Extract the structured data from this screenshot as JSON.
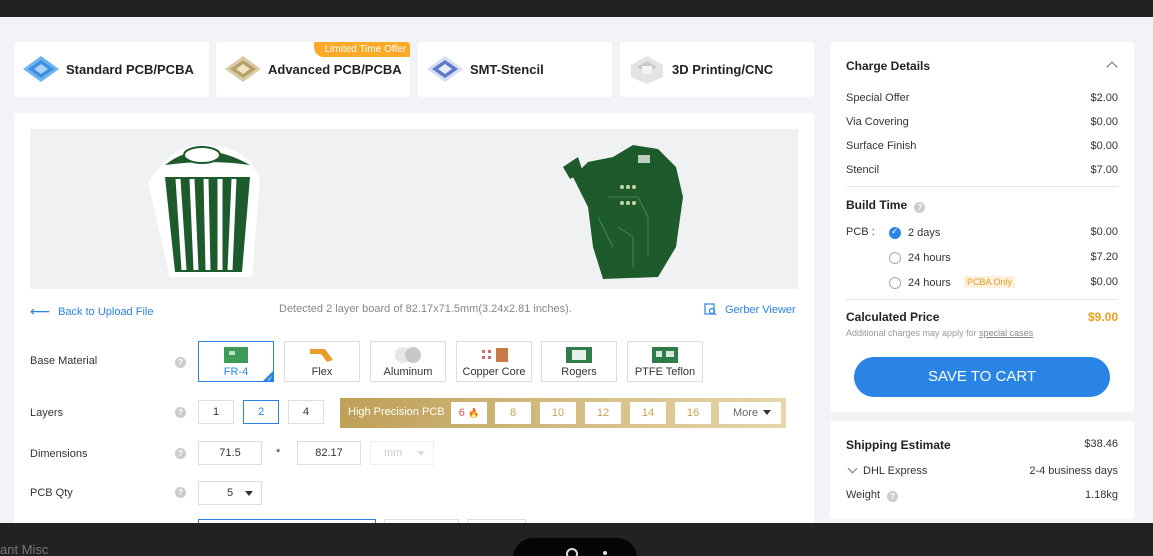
{
  "tabs": [
    {
      "label": "Standard PCB/PCBA"
    },
    {
      "label": "Advanced PCB/PCBA",
      "badge": "Limited Time Offer"
    },
    {
      "label": "SMT-Stencil"
    },
    {
      "label": "3D Printing/CNC"
    }
  ],
  "upload": {
    "back_label": "Back to Upload File",
    "detected_text": "Detected 2 layer board of 82.17x71.5mm(3.24x2.81 inches).",
    "gerber_label": "Gerber Viewer"
  },
  "fields": {
    "base_material": {
      "label": "Base Material",
      "options": [
        "FR-4",
        "Flex",
        "Aluminum",
        "Copper Core",
        "Rogers",
        "PTFE Teflon"
      ],
      "selected": "FR-4"
    },
    "layers": {
      "label": "Layers",
      "options": [
        "1",
        "2",
        "4"
      ],
      "selected": "2",
      "high_precision_label": "High Precision PCB",
      "high_precision_options": [
        "6",
        "8",
        "10",
        "12",
        "14",
        "16"
      ],
      "more_label": "More"
    },
    "dimensions": {
      "label": "Dimensions",
      "width": "71.5",
      "separator": "*",
      "height": "82.17",
      "unit": "mm"
    },
    "pcb_qty": {
      "label": "PCB Qty",
      "value": "5"
    },
    "help_icon": "?"
  },
  "charge": {
    "title": "Charge Details",
    "lines": [
      {
        "label": "Special Offer",
        "value": "$2.00"
      },
      {
        "label": "Via Covering",
        "value": "$0.00"
      },
      {
        "label": "Surface Finish",
        "value": "$0.00"
      },
      {
        "label": "Stencil",
        "value": "$7.00"
      }
    ],
    "build_time": {
      "title": "Build Time",
      "pcb_label": "PCB :",
      "options": [
        {
          "label": "2 days",
          "price": "$0.00",
          "selected": true
        },
        {
          "label": "24 hours",
          "price": "$7.20",
          "selected": false
        },
        {
          "label": "24 hours",
          "price": "$0.00",
          "selected": false,
          "tag": "PCBA Only"
        }
      ]
    },
    "calculated_label": "Calculated Price",
    "calculated_price": "$9.00",
    "additional_text": "Additional charges may apply for",
    "additional_link": "special cases",
    "save_button": "SAVE TO CART"
  },
  "shipping": {
    "title": "Shipping Estimate",
    "amount": "$38.46",
    "method": "DHL Express",
    "days": "2-4 business days",
    "weight_label": "Weight",
    "weight_value": "1.18kg"
  },
  "bottom": {
    "misc_text": "ant Misc"
  },
  "colors": {
    "accent": "#2a84e6",
    "price": "#f39a1b",
    "pcb_green": "#1d5a2c",
    "badge": "#ffa929"
  }
}
